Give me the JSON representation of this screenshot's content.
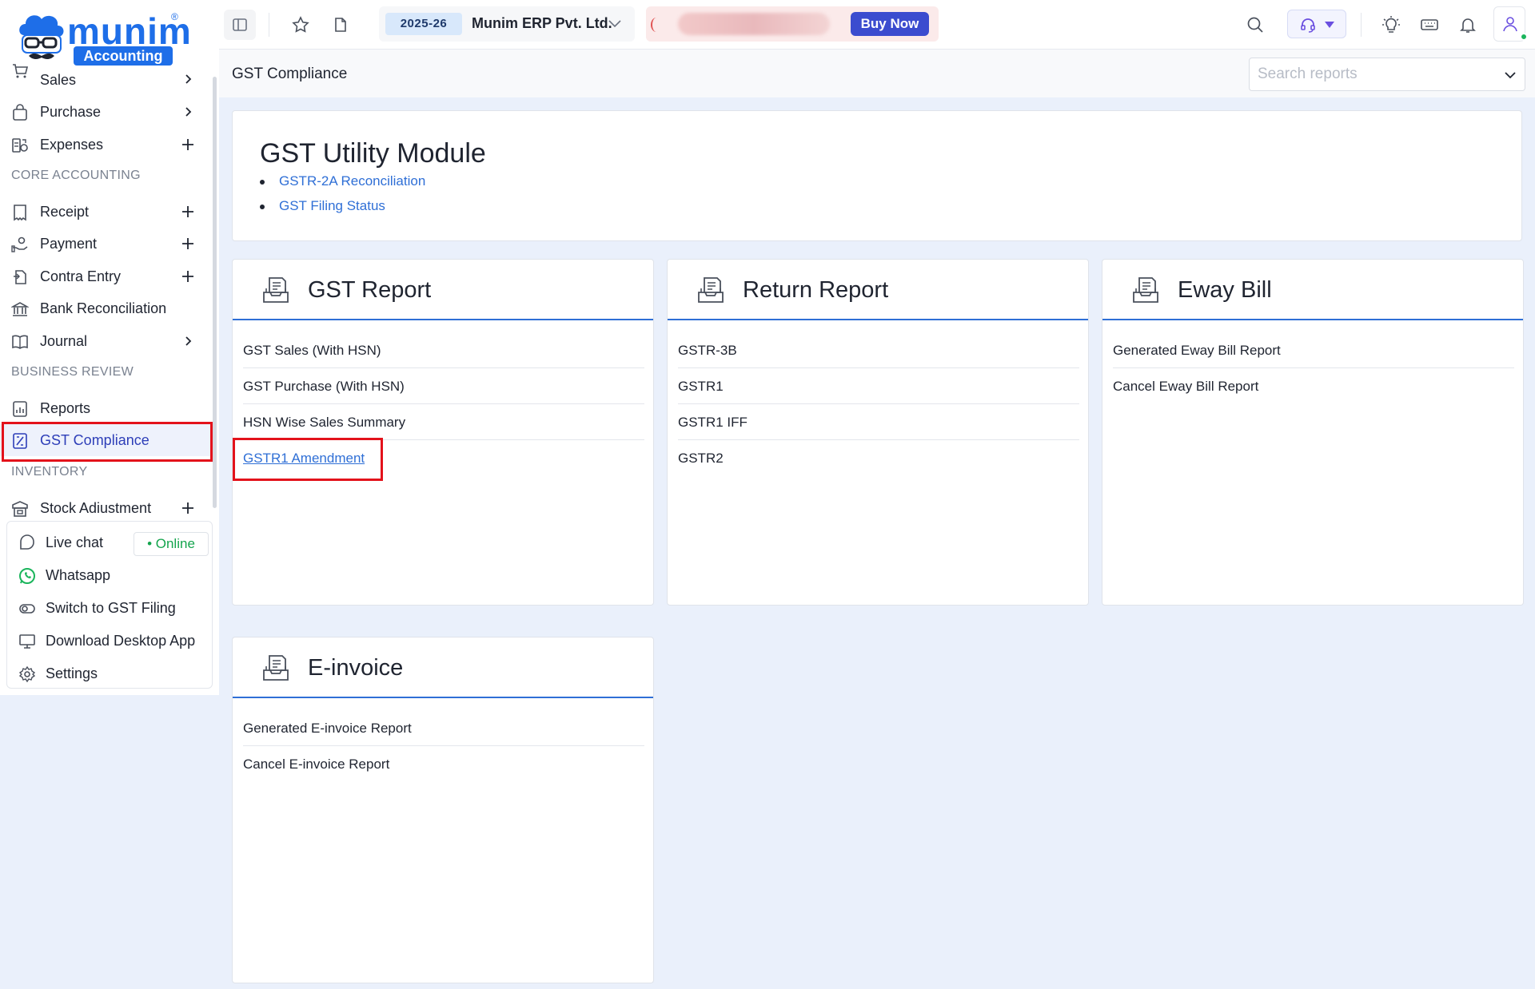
{
  "brand": {
    "name": "munim",
    "sub": "Accounting",
    "reg": "®"
  },
  "sidebar": {
    "items": [
      {
        "label": "Sales",
        "action": "chevron"
      },
      {
        "label": "Purchase",
        "action": "chevron"
      },
      {
        "label": "Expenses",
        "action": "plus"
      }
    ],
    "sections": {
      "core": "CORE ACCOUNTING",
      "business": "BUSINESS REVIEW",
      "inventory": "INVENTORY"
    },
    "core_items": [
      {
        "label": "Receipt",
        "action": "plus"
      },
      {
        "label": "Payment",
        "action": "plus"
      },
      {
        "label": "Contra Entry",
        "action": "plus"
      },
      {
        "label": "Bank Reconciliation",
        "action": ""
      },
      {
        "label": "Journal",
        "action": "chevron"
      }
    ],
    "business_items": [
      {
        "label": "Reports"
      },
      {
        "label": "GST Compliance"
      }
    ],
    "inventory_items": [
      {
        "label": "Stock Adiustment",
        "action": "plus"
      }
    ],
    "help": {
      "live_chat": "Live chat",
      "online": "• Online",
      "whatsapp": "Whatsapp",
      "switch": "Switch to GST Filing",
      "download": "Download Desktop App",
      "settings": "Settings"
    }
  },
  "topbar": {
    "year": "2025-26",
    "company": "Munim ERP Pvt. Ltd.",
    "buy_now": "Buy Now"
  },
  "page": {
    "title": "GST Compliance",
    "search_placeholder": "Search reports"
  },
  "utility": {
    "title": "GST Utility Module",
    "links": [
      "GSTR-2A Reconciliation",
      "GST Filing Status"
    ]
  },
  "cards": {
    "gst_report": {
      "title": "GST Report",
      "items": [
        "GST Sales (With HSN)",
        "GST Purchase (With HSN)",
        "HSN Wise Sales Summary",
        "GSTR1 Amendment"
      ]
    },
    "return_report": {
      "title": "Return Report",
      "items": [
        "GSTR-3B",
        "GSTR1",
        "GSTR1 IFF",
        "GSTR2"
      ]
    },
    "eway_bill": {
      "title": "Eway Bill",
      "items": [
        "Generated Eway Bill Report",
        "Cancel Eway Bill Report"
      ]
    },
    "einvoice": {
      "title": "E-invoice",
      "items": [
        "Generated E-invoice Report",
        "Cancel E-invoice Report"
      ]
    }
  },
  "colors": {
    "accent": "#2f6fd6",
    "buy_button": "#3b4ccf",
    "highlight": "#e3121b",
    "online": "#14a44d"
  }
}
